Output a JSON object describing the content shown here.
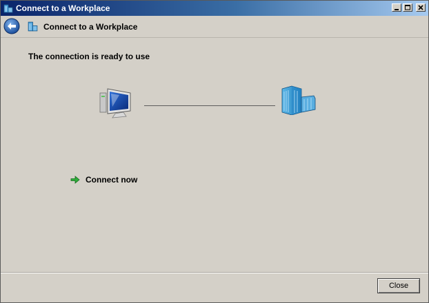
{
  "window": {
    "title": "Connect to a Workplace",
    "accent_color": "#0a246a"
  },
  "nav": {
    "back_icon": "back-arrow-icon",
    "title": "Connect to a Workplace"
  },
  "content": {
    "heading": "The connection is ready to use",
    "left_icon": "computer-icon",
    "right_icon": "workplace-building-icon",
    "connect_label": "Connect now",
    "connect_icon": "green-arrow-icon"
  },
  "footer": {
    "close_label": "Close"
  }
}
